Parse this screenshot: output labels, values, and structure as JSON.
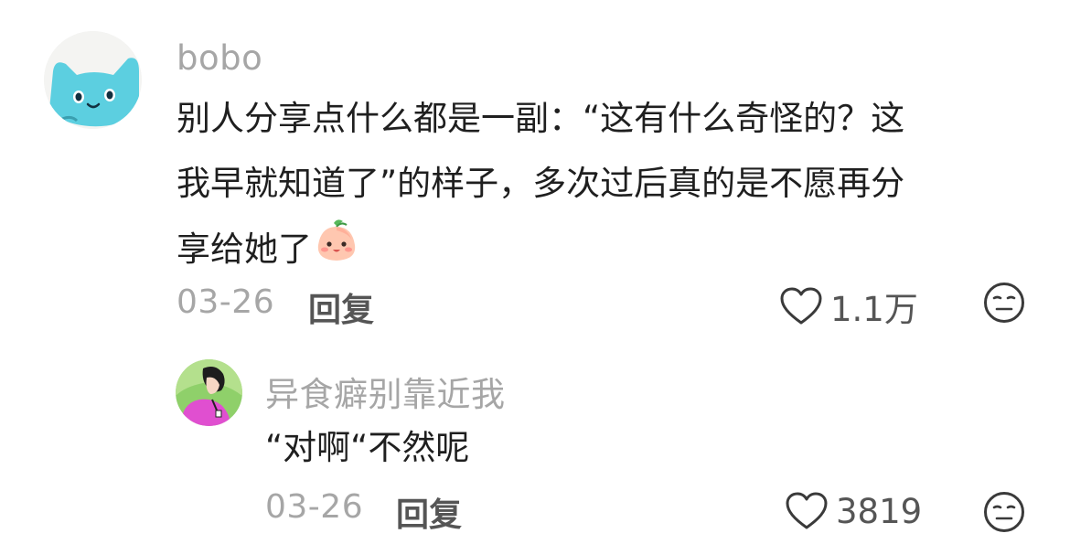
{
  "comments": [
    {
      "username": "bobo",
      "text": "别人分享点什么都是一副：“这有什么奇怪的？这我早就知道了”的样子，多次过后真的是不愿再分享给她了",
      "text_lines": [
        "别人分享点什么都是一副：“这有什么奇怪的？这",
        "我早就知道了”的样子，多次过后真的是不愿再分",
        "享给她了"
      ],
      "date": "03-26",
      "reply_label": "回复",
      "like_count": "1.1万",
      "avatar_icon": "blue-cat-avatar",
      "inline_emoji": "peach-face-emoji"
    },
    {
      "username": "异食癖别靠近我",
      "text": "“对啊“不然呢",
      "date": "03-26",
      "reply_label": "回复",
      "like_count": "3819",
      "avatar_icon": "girl-portrait-avatar"
    }
  ],
  "icons": {
    "like": "heart-outline-icon",
    "dislike": "meh-face-icon"
  },
  "colors": {
    "username": "#a6a6a6",
    "text": "#1f1f1f",
    "meta": "#a6a6a6",
    "action": "#555555",
    "icon": "#3a3a3a"
  }
}
